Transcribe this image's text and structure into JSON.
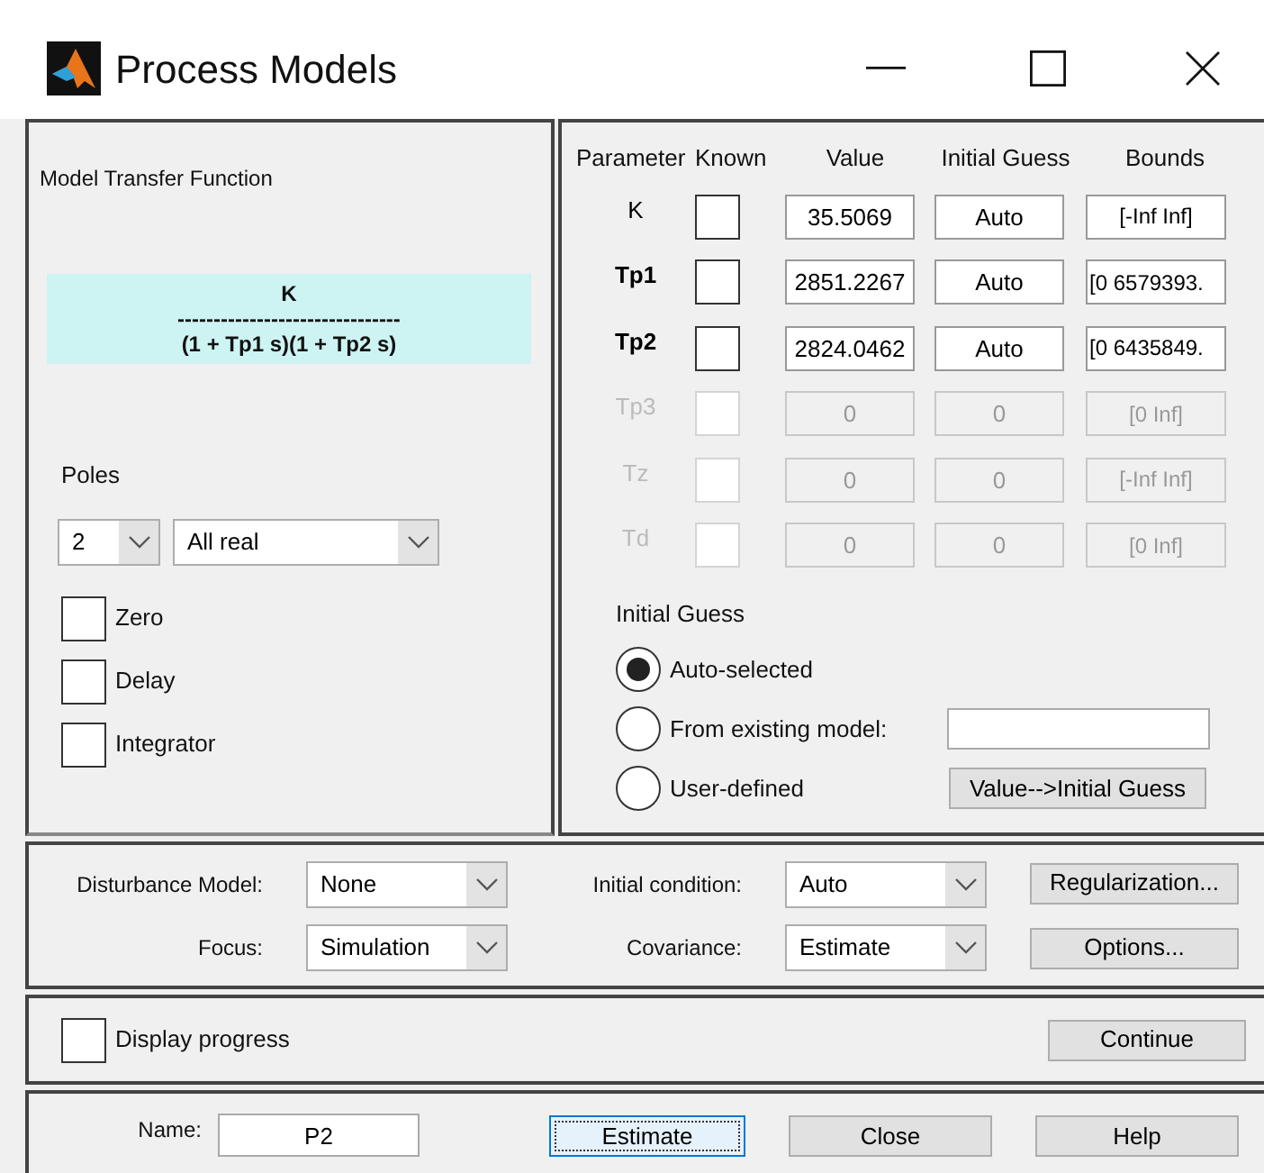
{
  "window": {
    "title": "Process Models"
  },
  "transfer_function": {
    "title": "Model Transfer Function",
    "numerator": "K",
    "divider": "-------------------------------",
    "denominator": "(1 + Tp1 s)(1 + Tp2 s)"
  },
  "poles": {
    "label": "Poles",
    "count": "2",
    "type": "All real"
  },
  "structure_options": [
    {
      "label": "Zero",
      "checked": false
    },
    {
      "label": "Delay",
      "checked": false
    },
    {
      "label": "Integrator",
      "checked": false
    }
  ],
  "parameters": {
    "columns": [
      "Parameter",
      "Known",
      "Value",
      "Initial Guess",
      "Bounds"
    ],
    "rows": [
      {
        "name": "K",
        "disabled": false,
        "known": false,
        "value": "35.5069",
        "initial_guess": "Auto",
        "bounds": "[-Inf Inf]"
      },
      {
        "name": "Tp1",
        "disabled": false,
        "known": false,
        "value": "2851.2267",
        "initial_guess": "Auto",
        "bounds": "[0 6579393."
      },
      {
        "name": "Tp2",
        "disabled": false,
        "known": false,
        "value": "2824.0462",
        "initial_guess": "Auto",
        "bounds": "[0 6435849."
      },
      {
        "name": "Tp3",
        "disabled": true,
        "known": false,
        "value": "0",
        "initial_guess": "0",
        "bounds": "[0 Inf]"
      },
      {
        "name": "Tz",
        "disabled": true,
        "known": false,
        "value": "0",
        "initial_guess": "0",
        "bounds": "[-Inf Inf]"
      },
      {
        "name": "Td",
        "disabled": true,
        "known": false,
        "value": "0",
        "initial_guess": "0",
        "bounds": "[0 Inf]"
      }
    ]
  },
  "initial_guess": {
    "title": "Initial Guess",
    "options": [
      {
        "label": "Auto-selected",
        "selected": true
      },
      {
        "label": "From existing model:",
        "selected": false
      },
      {
        "label": "User-defined",
        "selected": false
      }
    ],
    "transfer_button": "Value-->Initial Guess"
  },
  "settings": [
    {
      "label": "Disturbance Model:",
      "value": "None"
    },
    {
      "label": "Focus:",
      "value": "Simulation"
    },
    {
      "label": "Initial condition:",
      "value": "Auto"
    },
    {
      "label": "Covariance:",
      "value": "Estimate"
    }
  ],
  "settings_buttons": [
    "Regularization...",
    "Options..."
  ],
  "display_progress": {
    "label": "Display progress",
    "checked": false
  },
  "continue_button": "Continue",
  "name": {
    "label": "Name:",
    "value": "P2"
  },
  "buttons": [
    {
      "label": "Estimate",
      "focused": true
    },
    {
      "label": "Close",
      "focused": false
    },
    {
      "label": "Help",
      "focused": false
    }
  ]
}
